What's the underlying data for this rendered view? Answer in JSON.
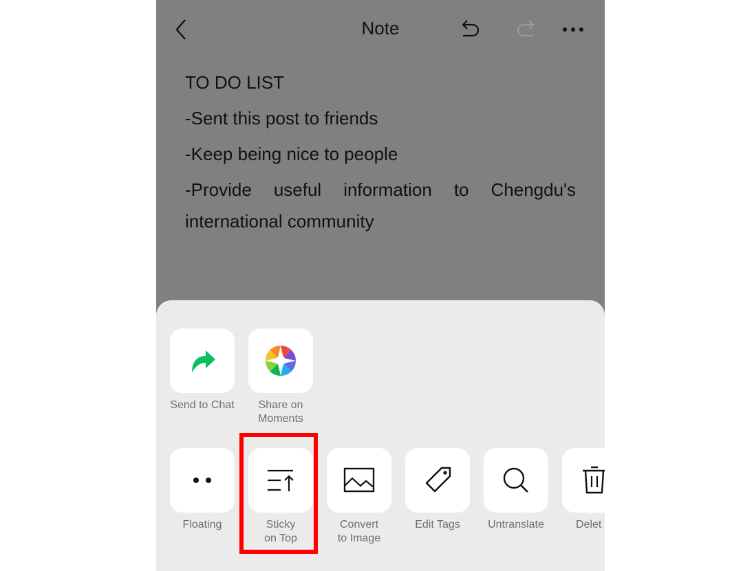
{
  "nav": {
    "title": "Note",
    "back_icon": "chevron-left-icon",
    "undo_icon": "undo-icon",
    "redo_icon": "redo-icon",
    "more_icon": "more-horizontal-icon"
  },
  "note": {
    "lines": [
      "TO DO LIST",
      "-Sent this post to friends",
      "-Keep being nice to people",
      "-Provide useful information to Chengdu's",
      "international community"
    ]
  },
  "sheet": {
    "row1": [
      {
        "label": "Send to Chat",
        "icon": "share-arrow-icon"
      },
      {
        "label": "Share on\nMoments",
        "label_line1": "Share on",
        "label_line2": "Moments",
        "icon": "moments-aperture-icon"
      }
    ],
    "row2": [
      {
        "label": "Floating",
        "icon": "floating-dots-icon"
      },
      {
        "label_line1": "Sticky",
        "label_line2": "on Top",
        "icon": "sticky-top-icon",
        "highlighted": true
      },
      {
        "label_line1": "Convert",
        "label_line2": "to Image",
        "icon": "image-icon"
      },
      {
        "label": "Edit Tags",
        "icon": "tag-icon"
      },
      {
        "label": "Untranslate",
        "icon": "search-icon"
      },
      {
        "label": "Delete",
        "visible_label": "Delet",
        "icon": "trash-icon"
      }
    ]
  },
  "colors": {
    "overlay": "#808080",
    "sheet": "#ebebeb",
    "highlight": "#ff0000",
    "send_green": "#07c160"
  }
}
